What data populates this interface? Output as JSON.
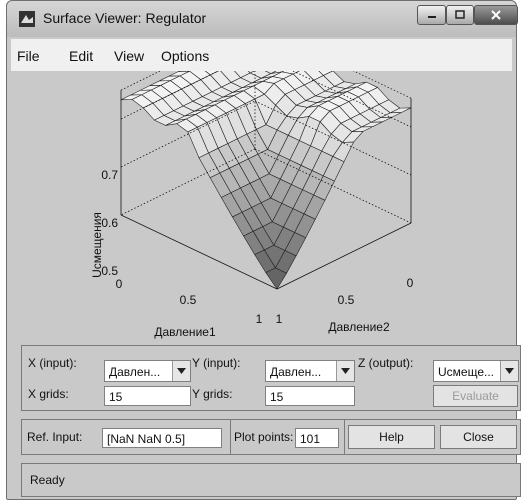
{
  "window": {
    "title": "Surface Viewer: Regulator"
  },
  "menu": [
    "File",
    "Edit",
    "View",
    "Options"
  ],
  "plot": {
    "zlabel": "Uсмещения",
    "xlabel": "Давление1",
    "ylabel": "Давление2",
    "z_ticks": [
      "0.5",
      "0.6",
      "0.7"
    ],
    "x_ticks": [
      "0",
      "0.5",
      "1"
    ],
    "y_ticks": [
      "1",
      "0.5",
      "0"
    ]
  },
  "controls": {
    "x_input_label": "X (input):",
    "x_input_value": "Давлен...",
    "y_input_label": "Y (input):",
    "y_input_value": "Давлен...",
    "z_output_label": "Z (output):",
    "z_output_value": "Uсмеще...",
    "x_grids_label": "X grids:",
    "x_grids_value": "15",
    "y_grids_label": "Y grids:",
    "y_grids_value": "15",
    "evaluate_label": "Evaluate",
    "ref_input_label": "Ref. Input:",
    "ref_input_value": "[NaN NaN 0.5]",
    "plot_points_label": "Plot points:",
    "plot_points_value": "101",
    "help_label": "Help",
    "close_label": "Close"
  },
  "status": {
    "text": "Ready"
  }
}
